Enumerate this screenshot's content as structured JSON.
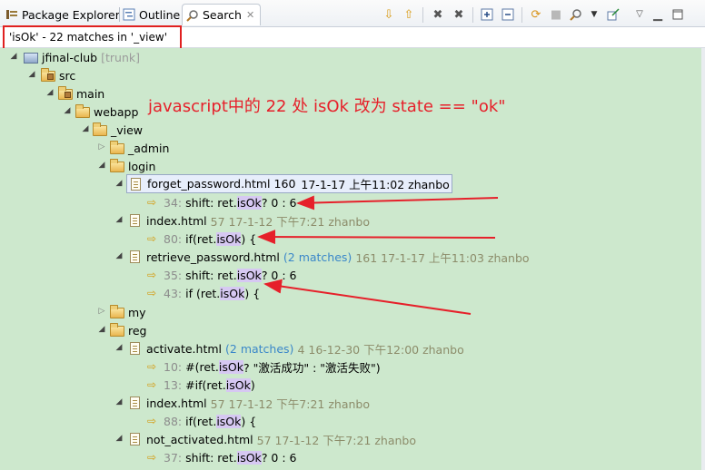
{
  "tabs": [
    {
      "label": "Package Explorer",
      "icon": "package-explorer-icon"
    },
    {
      "label": "Outline",
      "icon": "outline-icon"
    },
    {
      "label": "Search",
      "icon": "search-icon",
      "active": true
    }
  ],
  "summary": "'isOk' - 22 matches in '_view'",
  "annotation": "javascript中的 22 处 isOk 改为 state == \"ok\"",
  "tree": {
    "project": {
      "name": "jfinal-club",
      "branch": "[trunk]"
    },
    "src": "src",
    "main": "main",
    "webapp": "webapp",
    "view": "_view",
    "admin": "_admin",
    "login": "login",
    "forget_password": {
      "name": "forget_password.html",
      "count": "160",
      "meta": "17-1-17 上午11:02  zhanbo"
    },
    "forget_match": {
      "prefix": "34:",
      "pre": "shift: ret.",
      "hit": "isOk",
      "post": " ? 0 : 6"
    },
    "index1": {
      "name": "index.html",
      "meta": "57   17-1-12 下午7:21  zhanbo"
    },
    "index1_match": {
      "prefix": "80:",
      "pre": "if(ret.",
      "hit": "isOk",
      "post": ") {"
    },
    "retrieve": {
      "name": "retrieve_password.html",
      "matches": "(2 matches)",
      "meta": "161   17-1-17 上午11:03  zhanbo"
    },
    "retrieve_m1": {
      "prefix": "35:",
      "pre": "shift: ret.",
      "hit": "isOk",
      "post": " ? 0 : 6"
    },
    "retrieve_m2": {
      "prefix": "43:",
      "pre": "if (ret.",
      "hit": "isOk",
      "post": ") {"
    },
    "my": "my",
    "reg": "reg",
    "activate": {
      "name": "activate.html",
      "matches": "(2 matches)",
      "meta": "4   16-12-30 下午12:00  zhanbo"
    },
    "activate_m1": {
      "prefix": "10:",
      "pre": "#(ret.",
      "hit": "isOk",
      "post": " ? \"激活成功\" : \"激活失败\")"
    },
    "activate_m2": {
      "prefix": "13:",
      "pre": "#if(ret.",
      "hit": "isOk",
      "post": ")"
    },
    "index2": {
      "name": "index.html",
      "meta": "57   17-1-12 下午7:21  zhanbo"
    },
    "index2_match": {
      "prefix": "88:",
      "pre": "if(ret.",
      "hit": "isOk",
      "post": ") {"
    },
    "not_activated": {
      "name": "not_activated.html",
      "meta": "57   17-1-12 下午7:21  zhanbo"
    },
    "not_activated_match": {
      "prefix": "37:",
      "pre": "shift: ret.",
      "hit": "isOk",
      "post": " ? 0 : 6"
    }
  },
  "colors": {
    "tree_bg": "#cde8cd",
    "highlight": "#d6c8f2",
    "annotation": "#e6202a",
    "match_count": "#3a87c9"
  }
}
